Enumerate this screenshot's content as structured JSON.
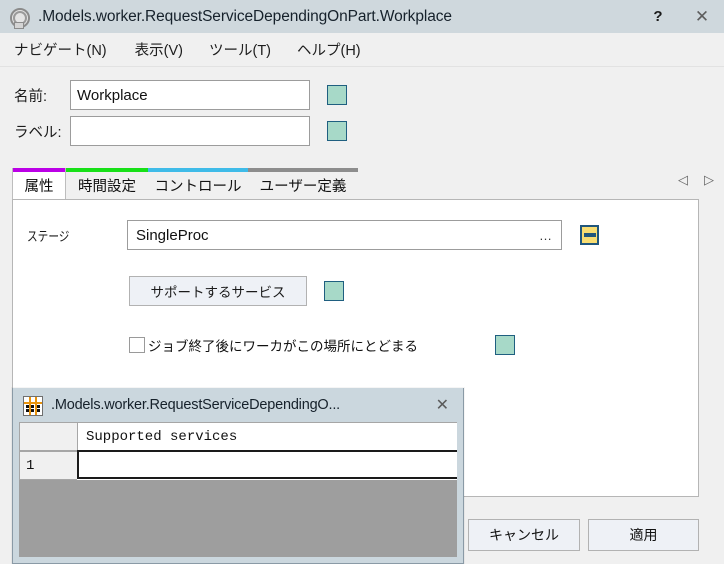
{
  "window": {
    "title": ".Models.worker.RequestServiceDependingOnPart.Workplace",
    "icon": "object-circle-icon",
    "help_label": "?",
    "close_label": "✕"
  },
  "menubar": {
    "items": [
      {
        "label": "ナビゲート(N)",
        "name": "menu-navigate"
      },
      {
        "label": "表示(V)",
        "name": "menu-view"
      },
      {
        "label": "ツール(T)",
        "name": "menu-tools"
      },
      {
        "label": "ヘルプ(H)",
        "name": "menu-help"
      }
    ]
  },
  "form": {
    "name_label": "名前:",
    "name_value": "Workplace",
    "name_placeholder": "",
    "label_label": "ラベル:",
    "label_value": "",
    "label_placeholder": ""
  },
  "tabs": {
    "items": [
      {
        "label": "属性",
        "color": "#bb00e6",
        "active": true
      },
      {
        "label": "時間設定",
        "color": "#18e018",
        "active": false
      },
      {
        "label": "コントロール",
        "color": "#3fbbe8",
        "active": false
      },
      {
        "label": "ユーザー定義",
        "color": "#8d8d8d",
        "active": false
      }
    ],
    "prev_arrow": "◁",
    "next_arrow": "▷"
  },
  "panel": {
    "stage_label": "ステージ",
    "stage_value": "SingleProc",
    "stage_ellipsis": "…",
    "services_button": "サポートするサービス",
    "stay_checkbox_label": "ジョブ終了後にワーカがこの場所にとどまる",
    "stay_checked": false
  },
  "footer": {
    "cancel_label": "キャンセル",
    "apply_label": "適用"
  },
  "subwindow": {
    "title": ".Models.worker.RequestServiceDependingO...",
    "icon": "table-grid-icon",
    "close_label": "✕",
    "table": {
      "columns": [
        "",
        "Supported services"
      ],
      "rows": [
        {
          "index": "1",
          "value": ""
        }
      ]
    }
  },
  "colors": {
    "titlebar": "#cfd8dd",
    "chip_fill": "#a7d9c8",
    "chip_border": "#1f5f80",
    "yellow_chip_fill": "#f8dd72",
    "yellow_chip_border": "#20567c",
    "panel_bg": "#ffffff",
    "window_bg": "#f0f0f0",
    "subwindow_body": "#9e9e9e"
  }
}
